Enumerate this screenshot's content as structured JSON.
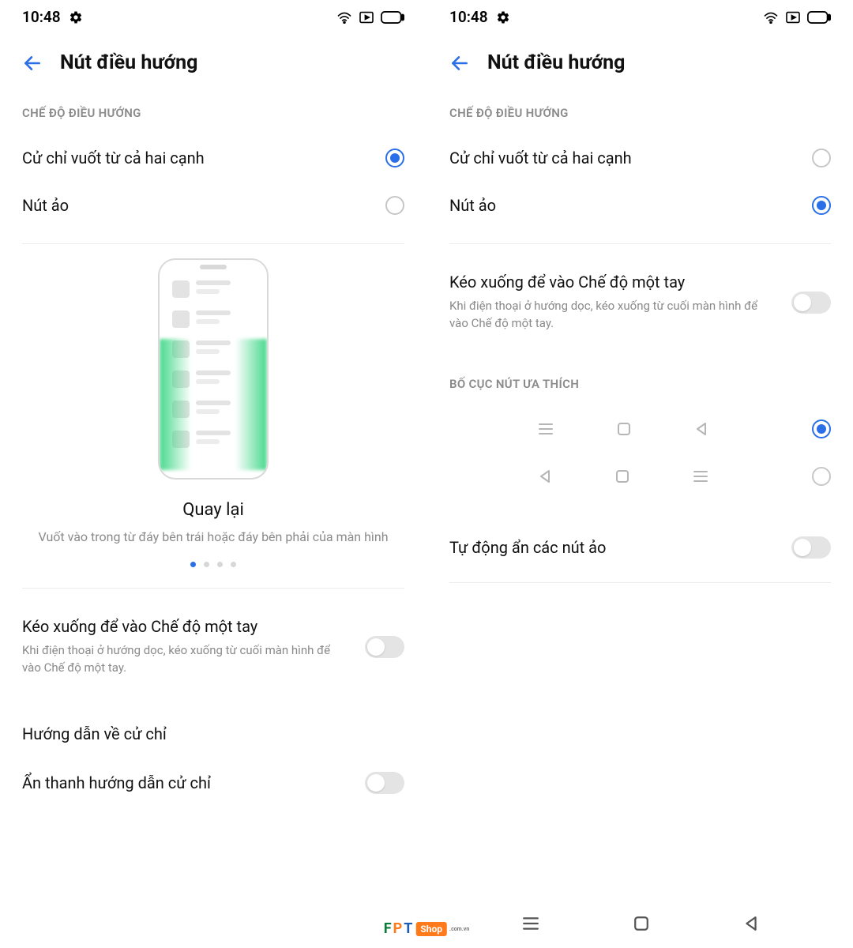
{
  "status": {
    "time": "10:48"
  },
  "header": {
    "title": "Nút điều hướng"
  },
  "left": {
    "section_mode": "CHẾ ĐỘ ĐIỀU HƯỚNG",
    "mode_swipe": "Cử chỉ vuốt từ cả hai cạnh",
    "mode_buttons": "Nút ảo",
    "illustration_title": "Quay lại",
    "illustration_desc": "Vuốt vào trong từ đáy bên trái hoặc đáy bên phải của màn hình",
    "one_hand_title": "Kéo xuống để vào Chế độ một tay",
    "one_hand_desc": "Khi điện thoại ở hướng dọc, kéo xuống từ cuối màn hình để vào Chế độ một tay.",
    "gesture_guide": "Hướng dẫn về cử chỉ",
    "hide_guide_bar": "Ẩn thanh hướng dẫn cử chỉ"
  },
  "right": {
    "section_mode": "CHẾ ĐỘ ĐIỀU HƯỚNG",
    "mode_swipe": "Cử chỉ vuốt từ cả hai cạnh",
    "mode_buttons": "Nút ảo",
    "one_hand_title": "Kéo xuống để vào Chế độ một tay",
    "one_hand_desc": "Khi điện thoại ở hướng dọc, kéo xuống từ cuối màn hình để vào Chế độ một tay.",
    "section_layout": "BỐ CỤC NÚT ƯA THÍCH",
    "auto_hide": "Tự động ẩn các nút ảo"
  },
  "watermark": {
    "f": "F",
    "p": "P",
    "t": "T",
    "shop": "Shop",
    "vn": ".com.vn"
  }
}
